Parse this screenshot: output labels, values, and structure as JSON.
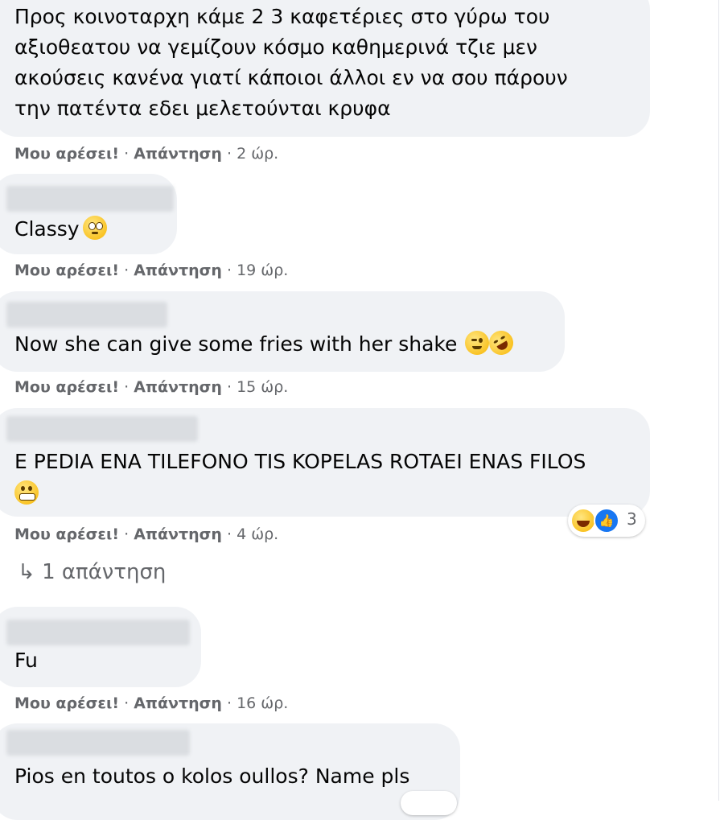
{
  "comments": [
    {
      "text_lines": [
        "Προς κοινοταρχη κάμε 2 3 καφετέριες στο γύρω του",
        "αξιοθεατου να γεμίζουν κόσμο καθημερινά τζιε μεν",
        "ακούσεις κανένα γιατί κάποιοι άλλοι εν να σου πάρουν",
        "την πατέντα εδει μελετούνται κρυφα"
      ],
      "like_label": "Μου αρέσει!",
      "reply_label": "Απάντηση",
      "sep": "·",
      "time": "2 ώρ."
    },
    {
      "text": "Classy",
      "emojis": [
        "flushed-face-emoji"
      ],
      "like_label": "Μου αρέσει!",
      "reply_label": "Απάντηση",
      "sep": "·",
      "time": "19 ώρ."
    },
    {
      "text": "Now she can give some fries with her shake",
      "emojis": [
        "winking-face-emoji",
        "rolling-laughing-emoji"
      ],
      "like_label": "Μου αρέσει!",
      "reply_label": "Απάντηση",
      "sep": "·",
      "time": "15 ώρ."
    },
    {
      "text": "E PEDIA ENA TILEFONO TIS KOPELAS ROTAEI ENAS FILOS",
      "emojis": [
        "grimacing-face-emoji"
      ],
      "reactions": {
        "icons": [
          "haha-reaction-icon",
          "like-reaction-icon"
        ],
        "count": "3"
      },
      "like_label": "Μου αρέσει!",
      "reply_label": "Απάντηση",
      "sep": "·",
      "time": "4 ώρ.",
      "replies_link": {
        "arrow": "↳",
        "label": "1 απάντηση"
      }
    },
    {
      "text": "Fu",
      "like_label": "Μου αρέσει!",
      "reply_label": "Απάντηση",
      "sep": "·",
      "time": "16 ώρ."
    },
    {
      "text": "Pios en toutos o kolos oullos? Name pls"
    }
  ],
  "colors": {
    "bubble": "#f0f2f5",
    "meta_text": "#65676b",
    "like_blue": "#1877f2",
    "emoji_yellow": "#f7b500"
  }
}
